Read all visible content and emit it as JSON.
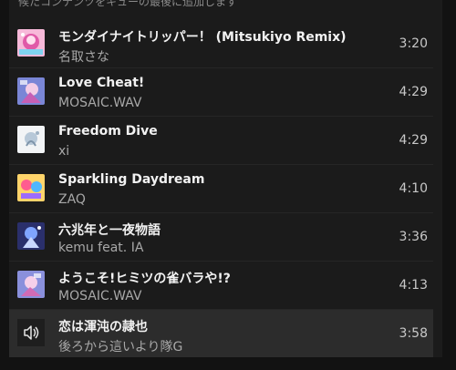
{
  "queue": {
    "hint": "候たコンテンツをキューの最後に追加します",
    "items": [
      {
        "title": "モンダイナイトリッパー！ (Mitsukiyo Remix)",
        "artist": "名取さな",
        "duration": "3:20"
      },
      {
        "title": "Love Cheat!",
        "artist": "MOSAIC.WAV",
        "duration": "4:29"
      },
      {
        "title": "Freedom Dive",
        "artist": "xi",
        "duration": "4:29"
      },
      {
        "title": "Sparkling Daydream",
        "artist": "ZAQ",
        "duration": "4:10"
      },
      {
        "title": "六兆年と一夜物語",
        "artist": "kemu feat. IA",
        "duration": "3:36"
      },
      {
        "title": "ようこそ!ヒミツの雀バラや!?",
        "artist": "MOSAIC.WAV",
        "duration": "4:13"
      },
      {
        "title": "恋は渾沌の隷也",
        "artist": "後ろから這いより隊G",
        "duration": "3:58"
      }
    ]
  }
}
